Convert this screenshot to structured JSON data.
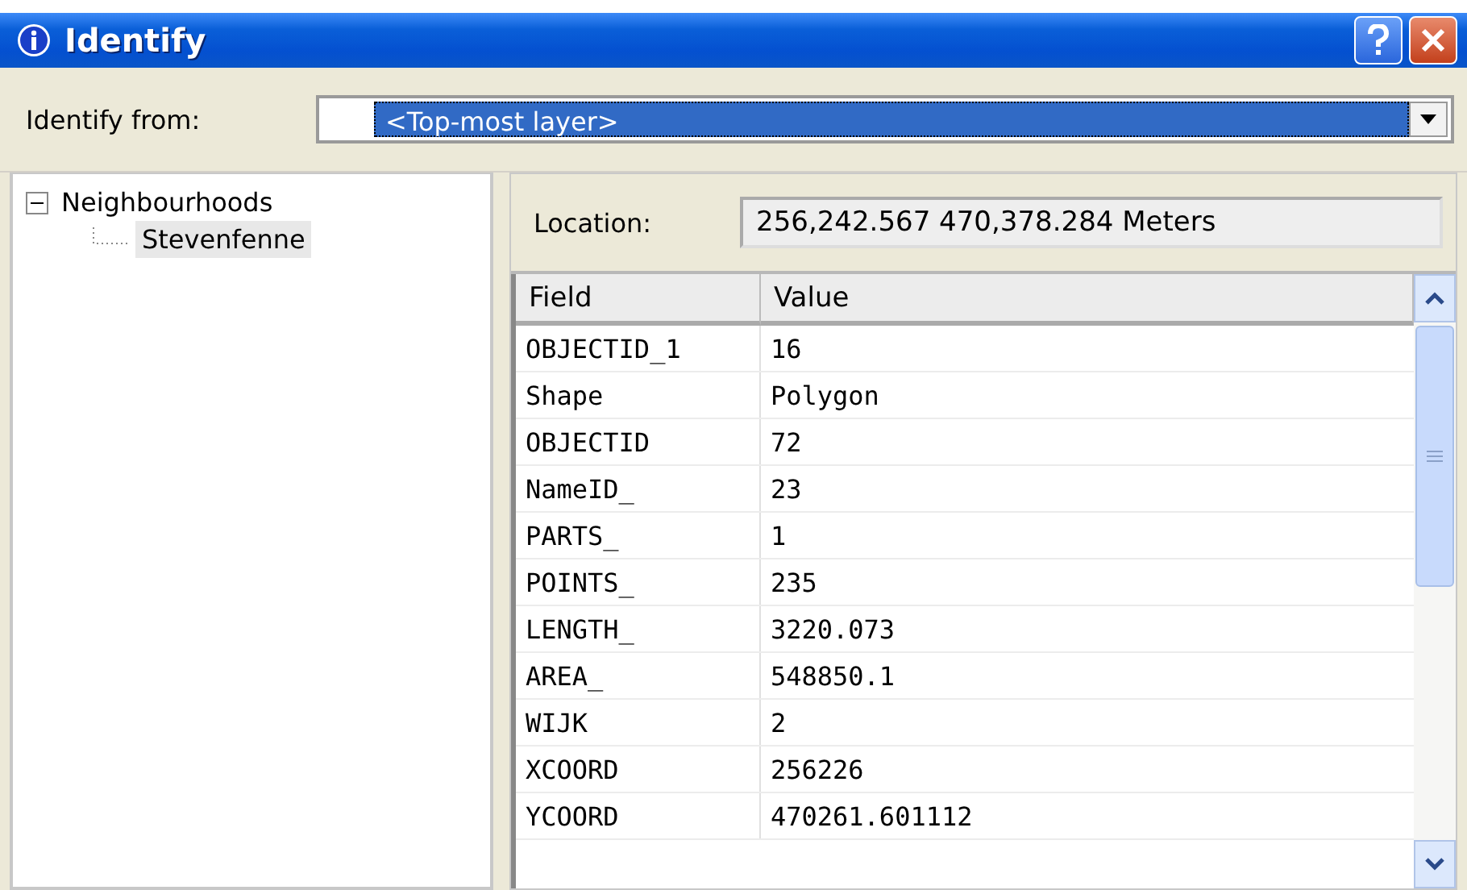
{
  "window": {
    "title": "Identify"
  },
  "identify_from": {
    "label": "Identify from:",
    "value": "<Top-most layer>"
  },
  "tree": [
    {
      "label": "Neighbourhoods",
      "expanded": true,
      "selected": false,
      "children": [
        {
          "label": "Stevenfenne",
          "selected": true
        }
      ]
    }
  ],
  "location": {
    "label": "Location:",
    "value": "256,242.567  470,378.284 Meters"
  },
  "table": {
    "columns": [
      "Field",
      "Value"
    ],
    "rows": [
      [
        "OBJECTID_1",
        "16"
      ],
      [
        "Shape",
        "Polygon"
      ],
      [
        "OBJECTID",
        "72"
      ],
      [
        "NameID_",
        "23"
      ],
      [
        "PARTS_",
        "1"
      ],
      [
        "POINTS_",
        "235"
      ],
      [
        "LENGTH_",
        "3220.073"
      ],
      [
        "AREA_",
        "548850.1"
      ],
      [
        "WIJK",
        "2"
      ],
      [
        "XCOORD",
        "256226"
      ],
      [
        "YCOORD",
        "470261.601112"
      ]
    ]
  }
}
